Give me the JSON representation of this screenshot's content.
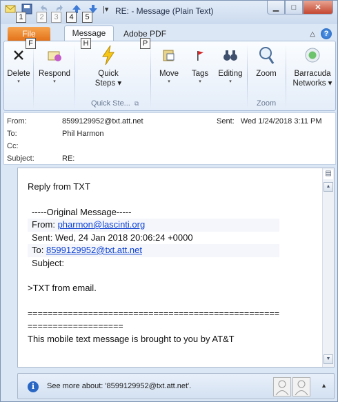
{
  "window": {
    "title": "RE:  - Message (Plain Text)",
    "minimize_icon": "minimize-icon",
    "maximize_icon": "maximize-icon",
    "close_icon": "close-icon"
  },
  "quick_access": {
    "badges": [
      "1",
      "2",
      "3",
      "4",
      "5"
    ]
  },
  "tabs": {
    "file": "File",
    "message": "Message",
    "adobe_pdf": "Adobe PDF",
    "keytip_file": "F",
    "keytip_message": "H",
    "keytip_pdf": "P"
  },
  "ribbon": {
    "delete": "Delete",
    "respond": "Respond",
    "quick_steps_line1": "Quick",
    "quick_steps_line2": "Steps",
    "quick_steps_group": "Quick Ste...",
    "move": "Move",
    "tags": "Tags",
    "editing": "Editing",
    "zoom": "Zoom",
    "zoom_group": "Zoom",
    "barracuda_line1": "Barracuda",
    "barracuda_line2": "Networks"
  },
  "header": {
    "from_label": "From:",
    "from_value": "8599129952@txt.att.net",
    "to_label": "To:",
    "to_value": "Phil Harmon",
    "cc_label": "Cc:",
    "cc_value": "",
    "subject_label": "Subject:",
    "subject_value": "RE:",
    "sent_label": "Sent:",
    "sent_value": "Wed 1/24/2018 3:11 PM"
  },
  "message": {
    "line1": "Reply from TXT",
    "orig_header": "-----Original Message-----",
    "from_prefix": "From: ",
    "from_link": "pharmon@lascinti.org",
    "sent_line": "Sent: Wed, 24 Jan 2018 20:06:24 +0000",
    "to_prefix": "To: ",
    "to_link": "8599129952@txt.att.net",
    "subject_line": "Subject:",
    "reply_text": ">TXT from email.",
    "rule1": "==================================================",
    "rule2": "===================",
    "footer": "This mobile text message is brought to you by AT&T"
  },
  "people_pane": {
    "text": "See more about: '8599129952@txt.att.net'."
  }
}
